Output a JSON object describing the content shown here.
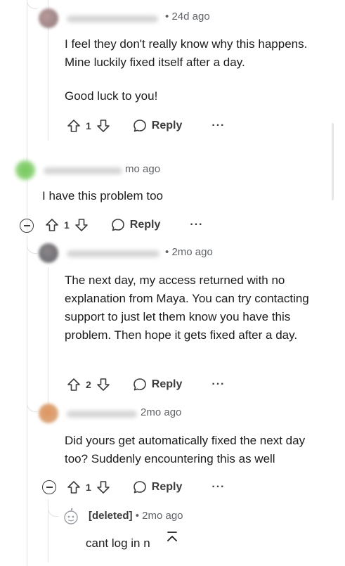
{
  "comments": [
    {
      "time": "24d ago",
      "paragraphs": [
        "I feel they don't really know why this happens. Mine luckily fixed itself after a day.",
        "Good luck to you!"
      ],
      "votes": "1",
      "reply_label": "Reply",
      "more_label": "···"
    },
    {
      "time": "mo ago",
      "paragraphs": [
        "I have this problem too"
      ],
      "votes": "1",
      "reply_label": "Reply",
      "more_label": "···"
    },
    {
      "time": "2mo ago",
      "paragraphs": [
        "The next day, my access returned with no explanation from Maya. You can try contacting support to just let them know you have this problem. Then hope it gets fixed after a day."
      ],
      "votes": "2",
      "reply_label": "Reply",
      "more_label": "···"
    },
    {
      "time": "2mo ago",
      "paragraphs": [
        "Did yours get automatically fixed the next day too? Suddenly encountering this as well"
      ],
      "votes": "1",
      "reply_label": "Reply",
      "more_label": "···"
    },
    {
      "author": "[deleted]",
      "time": "2mo ago",
      "paragraphs": [
        "cant log in n"
      ]
    }
  ],
  "meta_separator": "•",
  "scroll_top_icon": "chevron-up-icon",
  "colors": {
    "text": "#1c1c1c",
    "meta": "#5f6368",
    "thread": "#e2e2e2"
  }
}
